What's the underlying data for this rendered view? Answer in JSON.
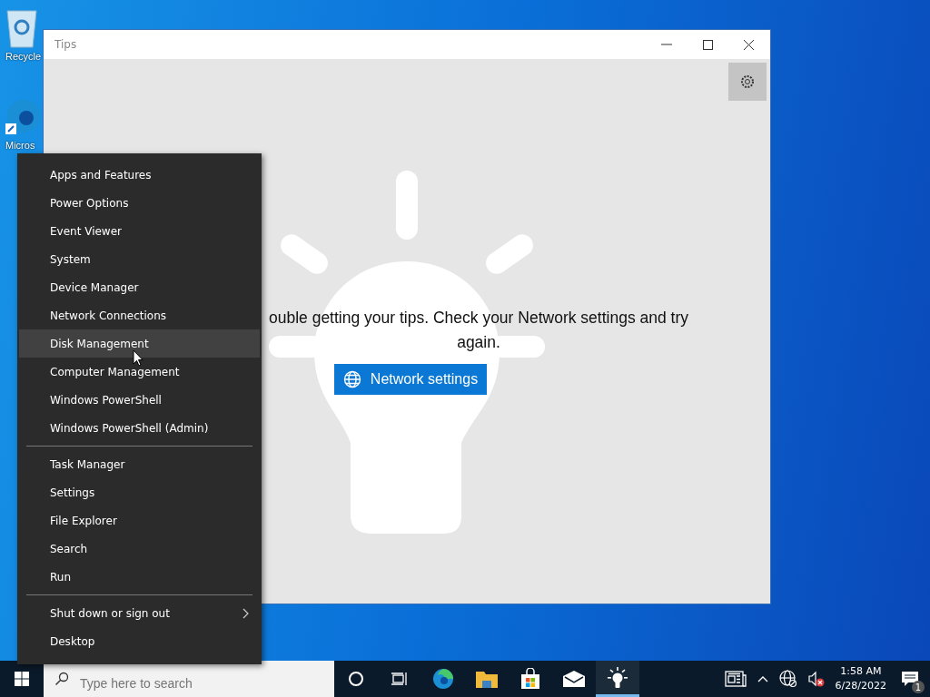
{
  "desktop_icons": [
    {
      "kind": "recycle-bin",
      "label": "Recycle"
    },
    {
      "kind": "browser",
      "label": "Micros"
    }
  ],
  "window": {
    "title": "Tips",
    "message": "ouble getting your tips. Check your Network settings and try again.",
    "button": "Network settings"
  },
  "context_menu": {
    "groups": [
      [
        {
          "label": "Apps and Features",
          "selected": false,
          "has_submenu": false
        },
        {
          "label": "Power Options",
          "selected": false,
          "has_submenu": false
        },
        {
          "label": "Event Viewer",
          "selected": false,
          "has_submenu": false
        },
        {
          "label": "System",
          "selected": false,
          "has_submenu": false
        },
        {
          "label": "Device Manager",
          "selected": false,
          "has_submenu": false
        },
        {
          "label": "Network Connections",
          "selected": false,
          "has_submenu": false
        },
        {
          "label": "Disk Management",
          "selected": true,
          "has_submenu": false
        },
        {
          "label": "Computer Management",
          "selected": false,
          "has_submenu": false
        },
        {
          "label": "Windows PowerShell",
          "selected": false,
          "has_submenu": false
        },
        {
          "label": "Windows PowerShell (Admin)",
          "selected": false,
          "has_submenu": false
        }
      ],
      [
        {
          "label": "Task Manager",
          "selected": false,
          "has_submenu": false
        },
        {
          "label": "Settings",
          "selected": false,
          "has_submenu": false
        },
        {
          "label": "File Explorer",
          "selected": false,
          "has_submenu": false
        },
        {
          "label": "Search",
          "selected": false,
          "has_submenu": false
        },
        {
          "label": "Run",
          "selected": false,
          "has_submenu": false
        }
      ],
      [
        {
          "label": "Shut down or sign out",
          "selected": false,
          "has_submenu": true
        },
        {
          "label": "Desktop",
          "selected": false,
          "has_submenu": false
        }
      ]
    ]
  },
  "taskbar": {
    "search": {
      "placeholder": "Type here to search"
    },
    "apps": [
      {
        "kind": "cortana",
        "active": false
      },
      {
        "kind": "task-view",
        "active": false
      },
      {
        "kind": "browser",
        "active": false
      },
      {
        "kind": "folder",
        "active": false
      },
      {
        "kind": "store",
        "active": false
      },
      {
        "kind": "mail",
        "active": false
      },
      {
        "kind": "bulb",
        "active": true
      }
    ],
    "time": "1:58 AM",
    "date": "6/28/2022",
    "notification_count": "1"
  }
}
